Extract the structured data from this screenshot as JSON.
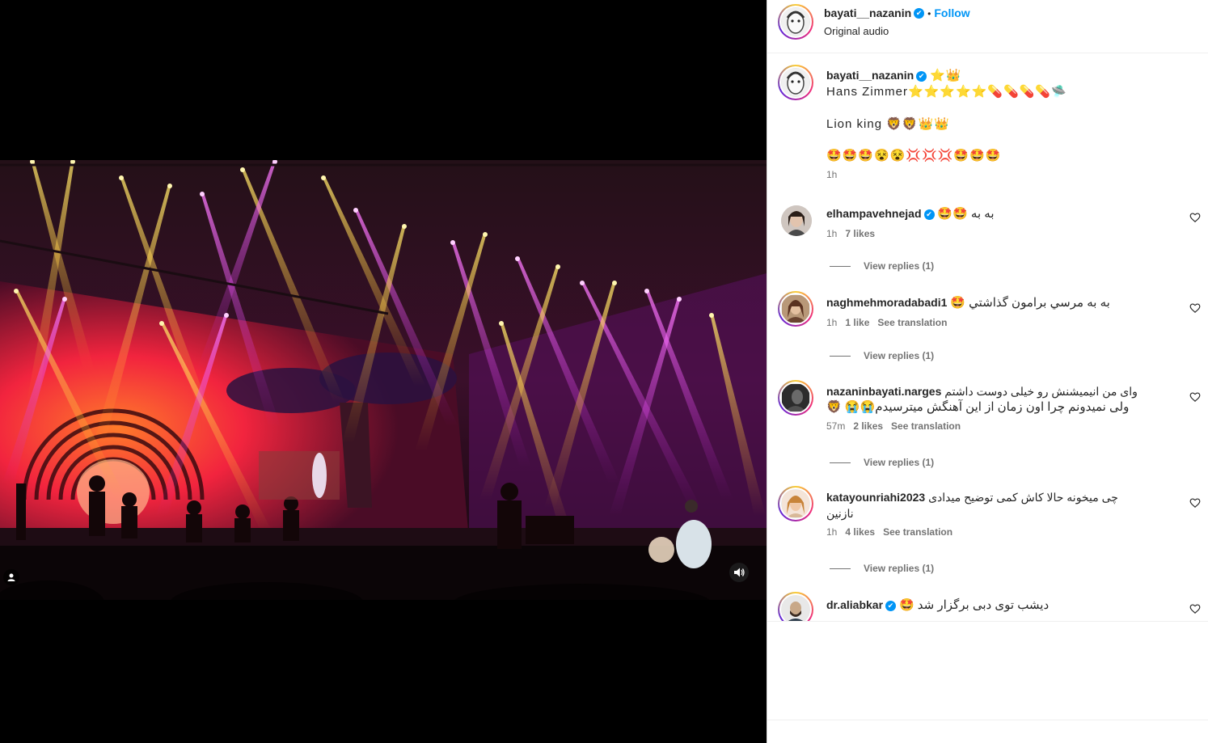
{
  "post": {
    "username": "bayati__nazanin",
    "follow_label": "Follow",
    "audio_label": "Original audio",
    "verified_mark": "✔"
  },
  "caption": {
    "username": "bayati__nazanin",
    "badges": "⭐👑",
    "line1": "Hans Zimmer⭐⭐⭐⭐⭐💊💊💊💊🛸",
    "line2": "Lion king 🦁🦁👑👑",
    "line3": "🤩🤩🤩😵😵💢💢💢🤩🤩🤩",
    "time": "1h"
  },
  "comments": [
    {
      "username": "elhampavehnejad",
      "verified": true,
      "text": "به به 🤩🤩",
      "time": "1h",
      "likes": "7 likes",
      "translation": "",
      "view_replies": "View replies (1)"
    },
    {
      "username": "naghmehmoradabadi1",
      "verified": false,
      "text": "به به مرسي برامون گذاشتي 🤩",
      "time": "1h",
      "likes": "1 like",
      "translation": "See translation",
      "view_replies": "View replies (1)"
    },
    {
      "username": "nazaninbayati.narges",
      "verified": false,
      "text": "وای من انیمیشنش رو خیلی دوست داشتم",
      "text2": "ولی نمیدونم چرا اون زمان از این آهنگش میترسیدم😭😭 🦁",
      "time": "57m",
      "likes": "2 likes",
      "translation": "See translation",
      "view_replies": "View replies (1)"
    },
    {
      "username": "katayounriahi2023",
      "verified": false,
      "text": "چی میخونه حالا کاش کمی توضیح میدادی",
      "text2": "نازنین",
      "time": "1h",
      "likes": "4 likes",
      "translation": "See translation",
      "view_replies": "View replies (1)"
    },
    {
      "username": "dr.aliabkar",
      "verified": true,
      "text": "دیشب توی دبی برگزار شد 🤩",
      "time": "",
      "likes": "",
      "translation": "",
      "view_replies": ""
    }
  ],
  "icons": {
    "heart": "heart-icon",
    "audio": "speaker-icon",
    "user_tag": "user-tag-icon"
  },
  "colors": {
    "accent": "#0095f6",
    "secondary_text": "#737373"
  }
}
